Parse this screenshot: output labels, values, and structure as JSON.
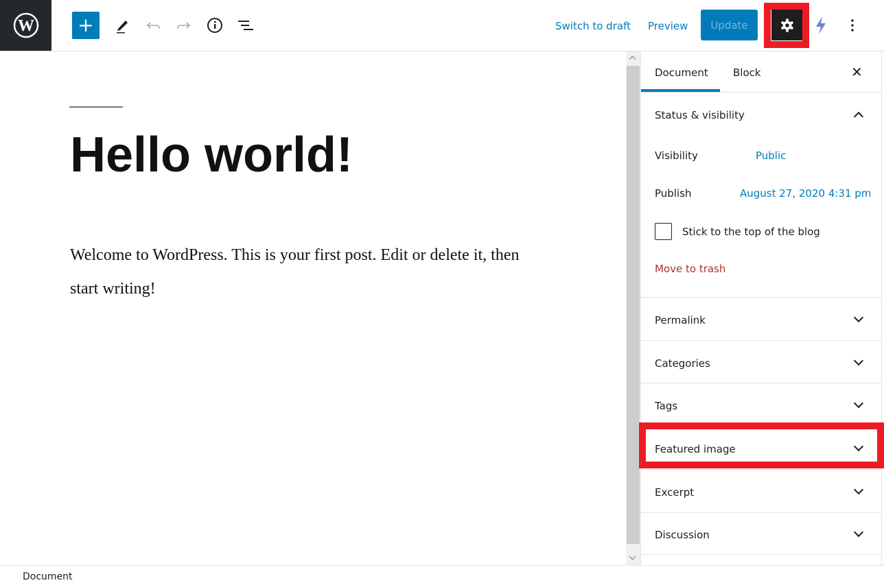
{
  "toolbar": {
    "switch_to_draft": "Switch to draft",
    "preview": "Preview",
    "update": "Update",
    "icons": [
      "wordpress-logo",
      "plus-icon",
      "pencil-icon",
      "undo-icon",
      "redo-icon",
      "info-icon",
      "list-view-icon",
      "gear-icon",
      "lightning-icon",
      "more-vertical-icon"
    ]
  },
  "editor": {
    "title": "Hello world!",
    "paragraph": "Welcome to WordPress. This is your first post. Edit or delete it, then start writing!"
  },
  "sidebar": {
    "tabs": [
      {
        "label": "Document",
        "active": true
      },
      {
        "label": "Block",
        "active": false
      }
    ],
    "status": {
      "title": "Status & visibility",
      "visibility_label": "Visibility",
      "visibility_value": "Public",
      "publish_label": "Publish",
      "publish_value": "August 27, 2020 4:31 pm",
      "sticky_label": "Stick to the top of the blog",
      "sticky_checked": false,
      "trash": "Move to trash"
    },
    "panels": [
      "Permalink",
      "Categories",
      "Tags",
      "Featured image",
      "Excerpt",
      "Discussion"
    ]
  },
  "footer": {
    "breadcrumb": "Document"
  },
  "colors": {
    "accent": "#007cba",
    "highlight": "#ed1c24",
    "trash": "#b32d2e"
  }
}
